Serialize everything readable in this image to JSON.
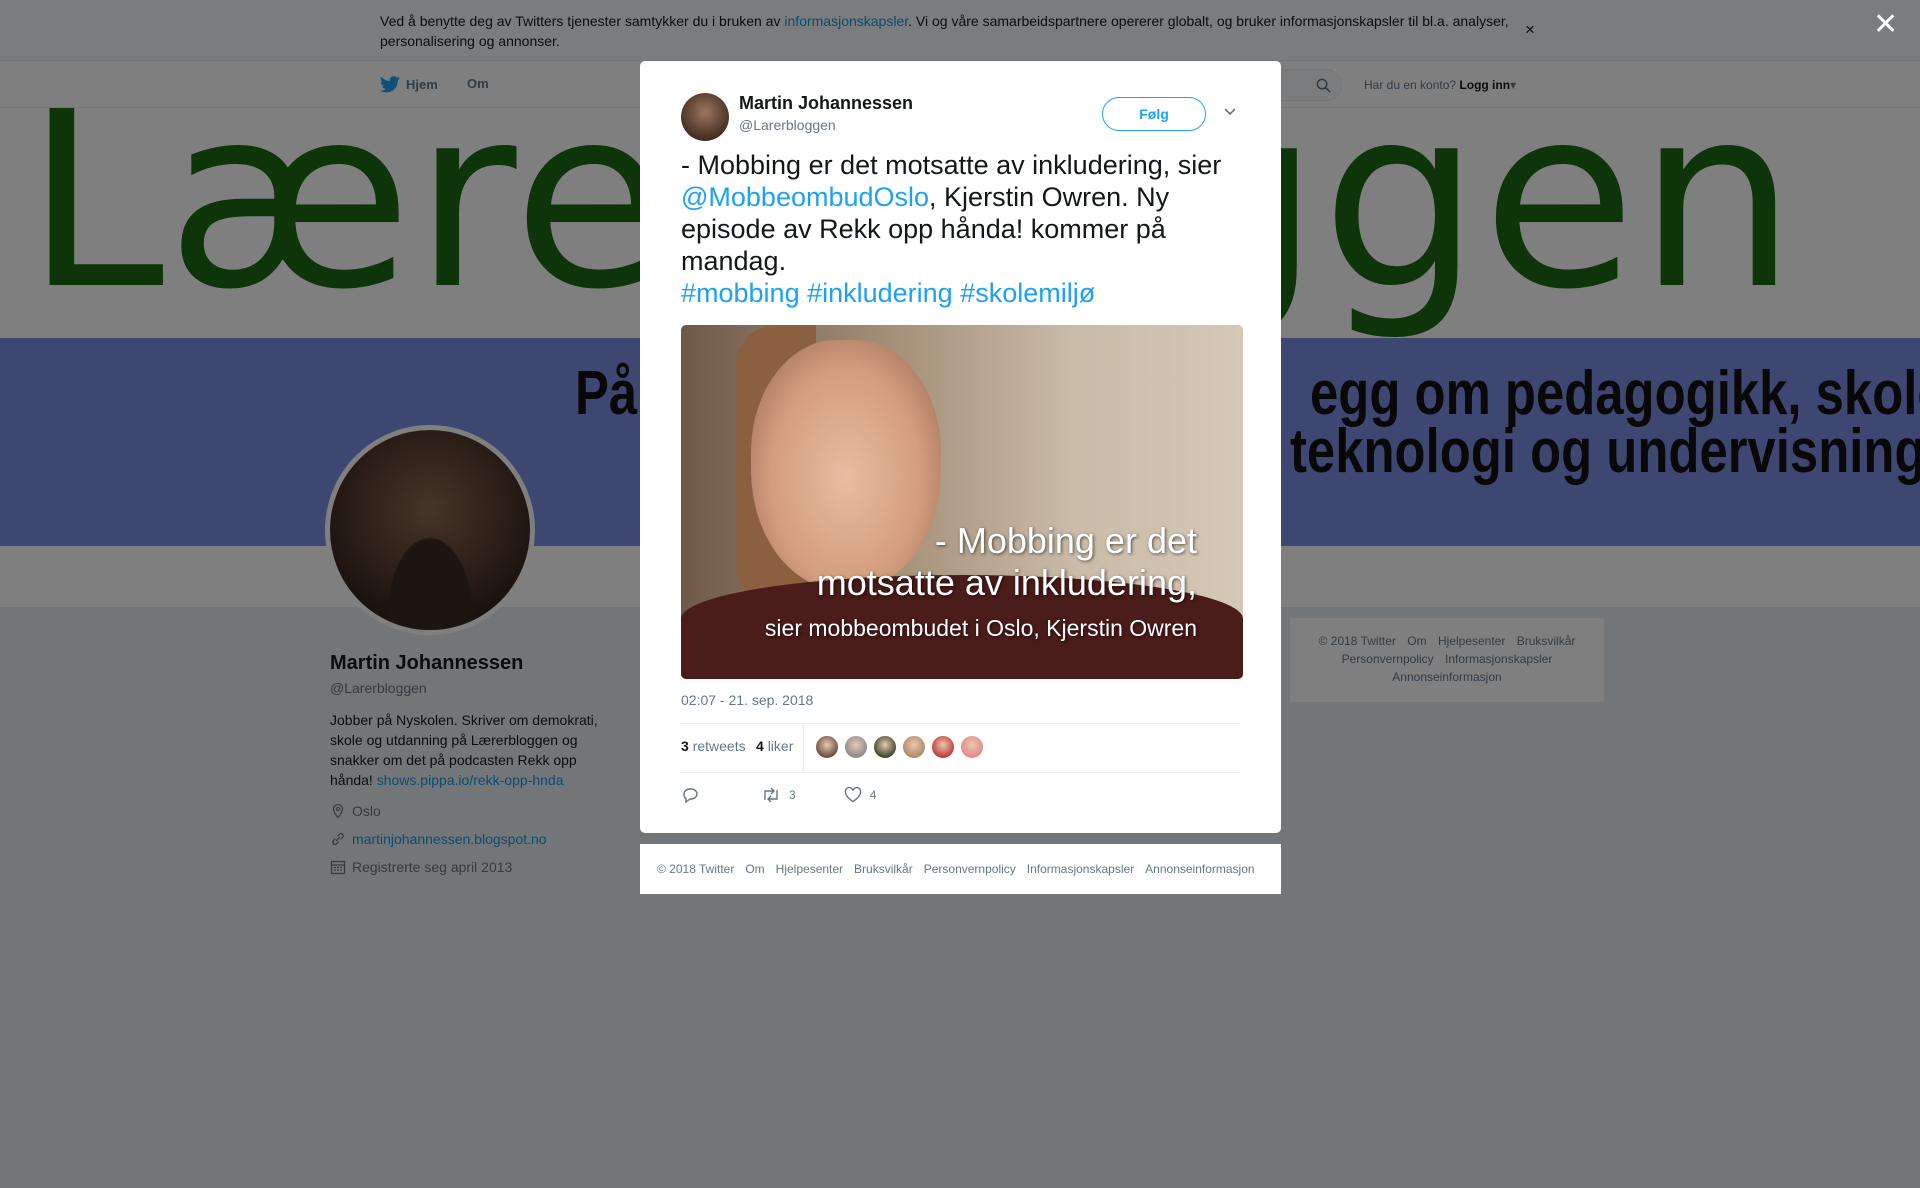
{
  "cookie": {
    "text_before": "Ved å benytte deg av Twitters tjenester samtykker du i bruken av ",
    "link": "informasjonskapsler",
    "text_after": ". Vi og våre samarbeidspartnere opererer globalt, og bruker informasjonskapsler til bl.a. analyser, personalisering og annonser.",
    "close": "×"
  },
  "nav": {
    "home": "Hjem",
    "about": "Om",
    "login_prompt": "Har du en konto?",
    "login": "Logg inn"
  },
  "banner": {
    "title": "Lærerbloggen",
    "line1": "På",
    "line2": "egg om pedagogikk, skole,",
    "line3": "teknologi og undervisning."
  },
  "profile": {
    "name": "Martin Johannessen",
    "handle": "@Larerbloggen",
    "bio": "Jobber på Nyskolen. Skriver om demokrati, skole og utdanning på Lærerbloggen og snakker om det på podcasten Rekk opp hånda! ",
    "bio_link": "shows.pippa.io/rekk-opp-hnda",
    "location": "Oslo",
    "website": "martinjohannessen.blogspot.no",
    "joined": "Registrerte seg april 2013"
  },
  "side_footer": {
    "items": [
      "© 2018 Twitter",
      "Om",
      "Hjelpesenter",
      "Bruksvilkår",
      "Personvernpolicy",
      "Informasjonskapsler",
      "Annonseinformasjon"
    ]
  },
  "overlay": {
    "close": "✕"
  },
  "tweet": {
    "author_name": "Martin Johannessen",
    "author_handle": "@Larerbloggen",
    "follow": "Følg",
    "caret": "⌄",
    "text_1": "- Mobbing er det motsatte av inkludering, sier ",
    "mention": "@MobbeombudOslo",
    "text_2": ", Kjerstin Owren. Ny episode av Rekk opp hånda! kommer på mandag.",
    "hashtags": "#mobbing #inkludering #skolemiljø",
    "media_caption_1": "- Mobbing er det",
    "media_caption_2": "motsatte av inkludering,",
    "media_caption_3": "sier mobbeombudet i Oslo, Kjerstin Owren",
    "timestamp": "02:07 - 21. sep. 2018",
    "retweet_count": "3",
    "retweet_label": "retweets",
    "like_count": "4",
    "like_label": "liker",
    "action_retweets": "3",
    "action_likes": "4",
    "liker_colors": [
      "#6b5142",
      "#8d8d8d",
      "#3f4a2e",
      "#b08a6a",
      "#c23b3b",
      "#e58a8a"
    ]
  },
  "modal_footer": {
    "items": [
      "© 2018 Twitter",
      "Om",
      "Hjelpesenter",
      "Bruksvilkår",
      "Personvernpolicy",
      "Informasjonskapsler",
      "Annonseinformasjon"
    ]
  }
}
